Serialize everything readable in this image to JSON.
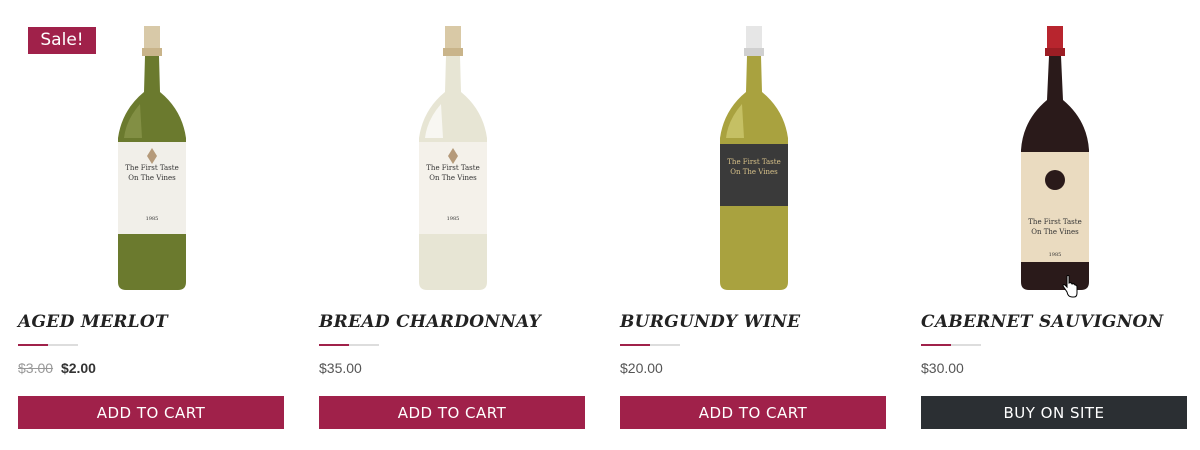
{
  "products": [
    {
      "name": "AGED MERLOT",
      "badge": "Sale!",
      "price_old": "$3.00",
      "price": "$2.00",
      "button": "ADD TO CART",
      "label_line1": "The First Taste",
      "label_line2": "On The Vines",
      "label_year": "1985"
    },
    {
      "name": "BREAD CHARDONNAY",
      "price": "$35.00",
      "button": "ADD TO CART",
      "label_line1": "The First Taste",
      "label_line2": "On The Vines",
      "label_year": "1985"
    },
    {
      "name": "BURGUNDY WINE",
      "price": "$20.00",
      "button": "ADD TO CART",
      "label_line1": "The First Taste",
      "label_line2": "On The Vines"
    },
    {
      "name": "CABERNET SAUVIGNON",
      "price": "$30.00",
      "button": "BUY ON SITE",
      "label_line1": "The First Taste",
      "label_line2": "On The Vines",
      "label_year": "1985"
    }
  ],
  "colors": {
    "accent": "#a0214a",
    "dark_button": "#2b2f33"
  },
  "icons": {
    "cursor": "hand-pointer-icon"
  }
}
